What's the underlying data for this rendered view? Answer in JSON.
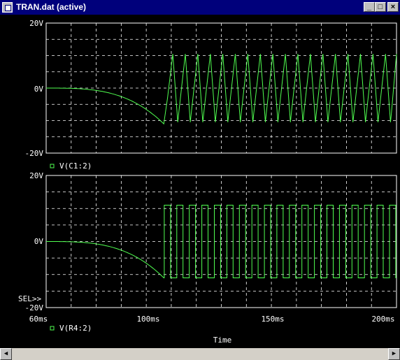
{
  "window": {
    "title": "TRAN.dat (active)"
  },
  "titlebar_buttons": {
    "minimize": "_",
    "maximize": "□",
    "close": "×"
  },
  "plot": {
    "colors": {
      "trace": "#50ff50",
      "axes": "#ffffff",
      "grid": "#ffffff",
      "background": "#000000"
    },
    "x_axis": {
      "label": "Time",
      "ticks": [
        "60ms",
        "100ms",
        "150ms",
        "200ms"
      ]
    },
    "top": {
      "yticks": [
        "20V",
        "0V",
        "-20V"
      ],
      "legend": "V(C1:2)"
    },
    "bottom": {
      "yticks": [
        "20V",
        "0V",
        "-20V"
      ],
      "legend": "V(R4:2)",
      "sel_marker": "SEL>>"
    }
  },
  "chart_data": [
    {
      "type": "line",
      "title": "",
      "xlabel": "Time",
      "xlim": [
        60,
        200
      ],
      "ylim": [
        -20,
        20
      ],
      "x_ticks": [
        "60ms",
        "100ms",
        "150ms",
        "200ms"
      ],
      "y_ticks": [
        "20V",
        "0V",
        "-20V"
      ],
      "grid": true,
      "series": [
        {
          "name": "V(C1:2)",
          "x": [
            60,
            70,
            80,
            90,
            95,
            100,
            103,
            105,
            107,
            107.8,
            108.2,
            110,
            111,
            113,
            115,
            116
          ],
          "y": [
            0,
            -0.2,
            -0.8,
            -2.5,
            -4.5,
            -7,
            -9.5,
            -10.5,
            -10.8,
            -8,
            -2,
            7,
            10.5,
            3,
            -10.5,
            -4
          ],
          "note": "continues as a triangle-like oscillation between about -10.5V and +10.5V with period about 5ms until 200ms"
        }
      ]
    },
    {
      "type": "line",
      "title": "",
      "xlabel": "Time",
      "xlim": [
        60,
        200
      ],
      "ylim": [
        -20,
        20
      ],
      "x_ticks": [
        "60ms",
        "100ms",
        "150ms",
        "200ms"
      ],
      "y_ticks": [
        "20V",
        "0V",
        "-20V"
      ],
      "grid": true,
      "series": [
        {
          "name": "V(R4:2)",
          "x": [
            60,
            70,
            80,
            90,
            95,
            100,
            103,
            105,
            107
          ],
          "y": [
            0,
            -0.2,
            -0.8,
            -2.5,
            -4.5,
            -7,
            -9.5,
            -10.5,
            -11
          ],
          "note": "from 107ms a square wave switching between about +11V and -11V with period about 5ms until 200ms"
        }
      ]
    }
  ]
}
